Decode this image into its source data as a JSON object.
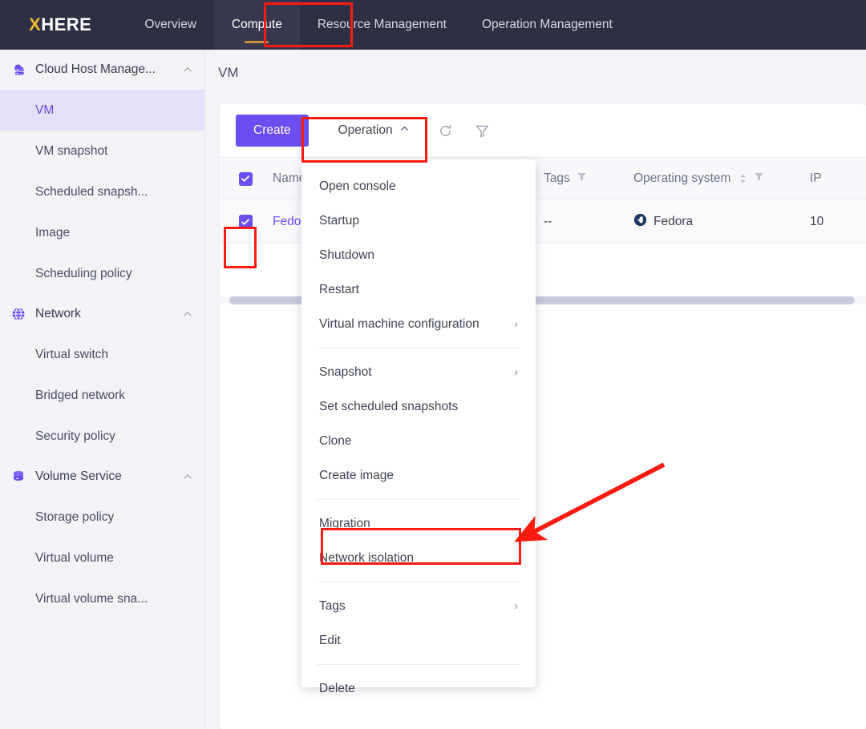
{
  "brand": {
    "prefix": "X",
    "rest": "HERE"
  },
  "topnav": {
    "tabs": [
      {
        "label": "Overview",
        "active": false
      },
      {
        "label": "Compute",
        "active": true
      },
      {
        "label": "Resource Management",
        "active": false
      },
      {
        "label": "Operation Management",
        "active": false
      }
    ]
  },
  "sidebar": {
    "groups": [
      {
        "label": "Cloud Host Manage...",
        "icon": "cloud-server-icon",
        "expanded": true,
        "items": [
          {
            "label": "VM",
            "active": true
          },
          {
            "label": "VM snapshot",
            "active": false
          },
          {
            "label": "Scheduled snapsh...",
            "active": false
          },
          {
            "label": "Image",
            "active": false
          },
          {
            "label": "Scheduling policy",
            "active": false
          }
        ]
      },
      {
        "label": "Network",
        "icon": "globe-icon",
        "expanded": true,
        "items": [
          {
            "label": "Virtual switch",
            "active": false
          },
          {
            "label": "Bridged network",
            "active": false
          },
          {
            "label": "Security policy",
            "active": false
          }
        ]
      },
      {
        "label": "Volume Service",
        "icon": "database-icon",
        "expanded": true,
        "items": [
          {
            "label": "Storage policy",
            "active": false
          },
          {
            "label": "Virtual volume",
            "active": false
          },
          {
            "label": "Virtual volume sna...",
            "active": false
          }
        ]
      }
    ]
  },
  "breadcrumb": {
    "title": "VM"
  },
  "toolbar": {
    "create_label": "Create",
    "operation_label": "Operation",
    "operation_caret": "chevron-up-icon",
    "refresh_icon": "refresh-icon",
    "filter_icon": "filter-icon"
  },
  "table": {
    "headers": {
      "name": "Name",
      "tags": "Tags",
      "operating_system": "Operating system",
      "ip": "IP"
    },
    "rows": [
      {
        "selected": true,
        "name": "Fedora-",
        "tags": "--",
        "os": "Fedora",
        "os_icon": "fedora-icon",
        "ip": "10"
      }
    ],
    "header_checkbox_checked": true
  },
  "operation_menu": {
    "items": [
      {
        "label": "Open console",
        "submenu": false,
        "separator_after": false
      },
      {
        "label": "Startup",
        "submenu": false,
        "separator_after": false
      },
      {
        "label": "Shutdown",
        "submenu": false,
        "separator_after": false
      },
      {
        "label": "Restart",
        "submenu": false,
        "separator_after": false
      },
      {
        "label": "Virtual machine configuration",
        "submenu": true,
        "separator_after": true
      },
      {
        "label": "Snapshot",
        "submenu": true,
        "separator_after": false
      },
      {
        "label": "Set scheduled snapshots",
        "submenu": false,
        "separator_after": false
      },
      {
        "label": "Clone",
        "submenu": false,
        "separator_after": false
      },
      {
        "label": "Create image",
        "submenu": false,
        "separator_after": true
      },
      {
        "label": "Migration",
        "submenu": false,
        "separator_after": false
      },
      {
        "label": "Network isolation",
        "submenu": false,
        "separator_after": true
      },
      {
        "label": "Tags",
        "submenu": true,
        "separator_after": false
      },
      {
        "label": "Edit",
        "submenu": false,
        "separator_after": true
      },
      {
        "label": "Delete",
        "submenu": false,
        "separator_after": false
      }
    ],
    "submenu_marker": "›"
  },
  "annotations": {
    "highlight_color": "#fc1b11",
    "boxes": [
      {
        "target": "Compute"
      },
      {
        "target": "Operation"
      },
      {
        "target": "row-checkbox"
      },
      {
        "target": "Network isolation"
      }
    ],
    "arrow": {
      "points_to": "Network isolation"
    }
  },
  "colors": {
    "nav_background": "#2e2f45",
    "nav_active_background": "#37384f",
    "nav_underline": "#c9912f",
    "brand_accent": "#e8b830",
    "primary": "#6c4df0",
    "sidebar_background": "#f2f2f7",
    "sidebar_active_background": "#e3e0fa"
  }
}
